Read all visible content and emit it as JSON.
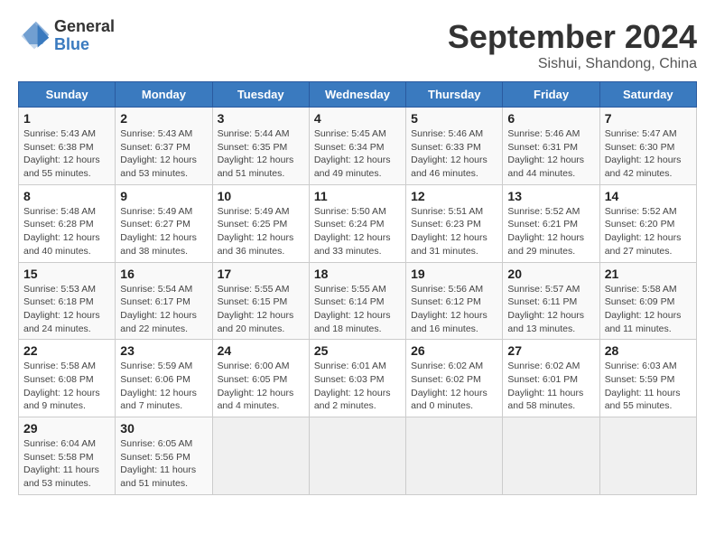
{
  "header": {
    "logo_general": "General",
    "logo_blue": "Blue",
    "month": "September 2024",
    "location": "Sishui, Shandong, China"
  },
  "weekdays": [
    "Sunday",
    "Monday",
    "Tuesday",
    "Wednesday",
    "Thursday",
    "Friday",
    "Saturday"
  ],
  "weeks": [
    [
      {
        "day": "1",
        "sunrise": "5:43 AM",
        "sunset": "6:38 PM",
        "daylight": "12 hours and 55 minutes."
      },
      {
        "day": "2",
        "sunrise": "5:43 AM",
        "sunset": "6:37 PM",
        "daylight": "12 hours and 53 minutes."
      },
      {
        "day": "3",
        "sunrise": "5:44 AM",
        "sunset": "6:35 PM",
        "daylight": "12 hours and 51 minutes."
      },
      {
        "day": "4",
        "sunrise": "5:45 AM",
        "sunset": "6:34 PM",
        "daylight": "12 hours and 49 minutes."
      },
      {
        "day": "5",
        "sunrise": "5:46 AM",
        "sunset": "6:33 PM",
        "daylight": "12 hours and 46 minutes."
      },
      {
        "day": "6",
        "sunrise": "5:46 AM",
        "sunset": "6:31 PM",
        "daylight": "12 hours and 44 minutes."
      },
      {
        "day": "7",
        "sunrise": "5:47 AM",
        "sunset": "6:30 PM",
        "daylight": "12 hours and 42 minutes."
      }
    ],
    [
      {
        "day": "8",
        "sunrise": "5:48 AM",
        "sunset": "6:28 PM",
        "daylight": "12 hours and 40 minutes."
      },
      {
        "day": "9",
        "sunrise": "5:49 AM",
        "sunset": "6:27 PM",
        "daylight": "12 hours and 38 minutes."
      },
      {
        "day": "10",
        "sunrise": "5:49 AM",
        "sunset": "6:25 PM",
        "daylight": "12 hours and 36 minutes."
      },
      {
        "day": "11",
        "sunrise": "5:50 AM",
        "sunset": "6:24 PM",
        "daylight": "12 hours and 33 minutes."
      },
      {
        "day": "12",
        "sunrise": "5:51 AM",
        "sunset": "6:23 PM",
        "daylight": "12 hours and 31 minutes."
      },
      {
        "day": "13",
        "sunrise": "5:52 AM",
        "sunset": "6:21 PM",
        "daylight": "12 hours and 29 minutes."
      },
      {
        "day": "14",
        "sunrise": "5:52 AM",
        "sunset": "6:20 PM",
        "daylight": "12 hours and 27 minutes."
      }
    ],
    [
      {
        "day": "15",
        "sunrise": "5:53 AM",
        "sunset": "6:18 PM",
        "daylight": "12 hours and 24 minutes."
      },
      {
        "day": "16",
        "sunrise": "5:54 AM",
        "sunset": "6:17 PM",
        "daylight": "12 hours and 22 minutes."
      },
      {
        "day": "17",
        "sunrise": "5:55 AM",
        "sunset": "6:15 PM",
        "daylight": "12 hours and 20 minutes."
      },
      {
        "day": "18",
        "sunrise": "5:55 AM",
        "sunset": "6:14 PM",
        "daylight": "12 hours and 18 minutes."
      },
      {
        "day": "19",
        "sunrise": "5:56 AM",
        "sunset": "6:12 PM",
        "daylight": "12 hours and 16 minutes."
      },
      {
        "day": "20",
        "sunrise": "5:57 AM",
        "sunset": "6:11 PM",
        "daylight": "12 hours and 13 minutes."
      },
      {
        "day": "21",
        "sunrise": "5:58 AM",
        "sunset": "6:09 PM",
        "daylight": "12 hours and 11 minutes."
      }
    ],
    [
      {
        "day": "22",
        "sunrise": "5:58 AM",
        "sunset": "6:08 PM",
        "daylight": "12 hours and 9 minutes."
      },
      {
        "day": "23",
        "sunrise": "5:59 AM",
        "sunset": "6:06 PM",
        "daylight": "12 hours and 7 minutes."
      },
      {
        "day": "24",
        "sunrise": "6:00 AM",
        "sunset": "6:05 PM",
        "daylight": "12 hours and 4 minutes."
      },
      {
        "day": "25",
        "sunrise": "6:01 AM",
        "sunset": "6:03 PM",
        "daylight": "12 hours and 2 minutes."
      },
      {
        "day": "26",
        "sunrise": "6:02 AM",
        "sunset": "6:02 PM",
        "daylight": "12 hours and 0 minutes."
      },
      {
        "day": "27",
        "sunrise": "6:02 AM",
        "sunset": "6:01 PM",
        "daylight": "11 hours and 58 minutes."
      },
      {
        "day": "28",
        "sunrise": "6:03 AM",
        "sunset": "5:59 PM",
        "daylight": "11 hours and 55 minutes."
      }
    ],
    [
      {
        "day": "29",
        "sunrise": "6:04 AM",
        "sunset": "5:58 PM",
        "daylight": "11 hours and 53 minutes."
      },
      {
        "day": "30",
        "sunrise": "6:05 AM",
        "sunset": "5:56 PM",
        "daylight": "11 hours and 51 minutes."
      },
      null,
      null,
      null,
      null,
      null
    ]
  ],
  "labels": {
    "sunrise": "Sunrise: ",
    "sunset": "Sunset: ",
    "daylight": "Daylight: "
  }
}
